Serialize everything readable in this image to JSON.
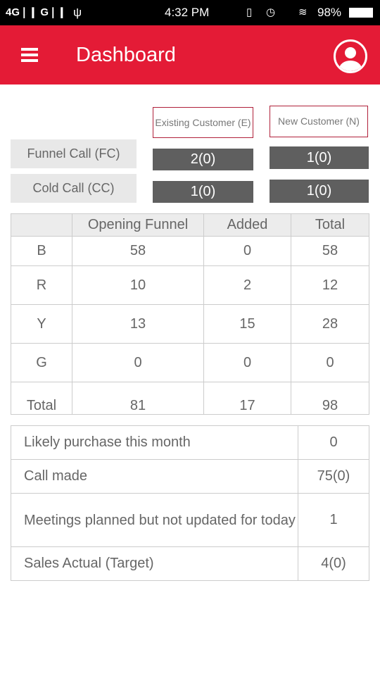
{
  "status": {
    "network": "4G❘❙ G❘❙",
    "time": "4:32 PM",
    "battery": "98%"
  },
  "header": {
    "title": "Dashboard",
    "menu_icon": "hamburger-icon",
    "profile_icon": "user-icon"
  },
  "summary": {
    "columns": [
      "Existing Customer (E)",
      "New Customer (N)"
    ],
    "rows": [
      {
        "label": "Funnel Call (FC)",
        "values": [
          "2(0)",
          "1(0)"
        ]
      },
      {
        "label": "Cold Call (CC)",
        "values": [
          "1(0)",
          "1(0)"
        ]
      }
    ]
  },
  "funnel": {
    "headers": [
      "",
      "Opening Funnel",
      "Added",
      "Total"
    ],
    "rows": [
      [
        "B",
        "58",
        "0",
        "58"
      ],
      [
        "R",
        "10",
        "2",
        "12"
      ],
      [
        "Y",
        "13",
        "15",
        "28"
      ],
      [
        "G",
        "0",
        "0",
        "0"
      ],
      [
        "Total",
        "81",
        "17",
        "98"
      ]
    ]
  },
  "metrics": [
    {
      "label": "Likely purchase this month",
      "value": "0"
    },
    {
      "label": "Call made",
      "value": "75(0)"
    },
    {
      "label": "Meetings planned but not updated for today",
      "value": "1"
    },
    {
      "label": "Sales Actual (Target)",
      "value": "4(0)"
    }
  ],
  "colors": {
    "brand": "#e41b36",
    "value_bg": "#5f5f5f"
  }
}
